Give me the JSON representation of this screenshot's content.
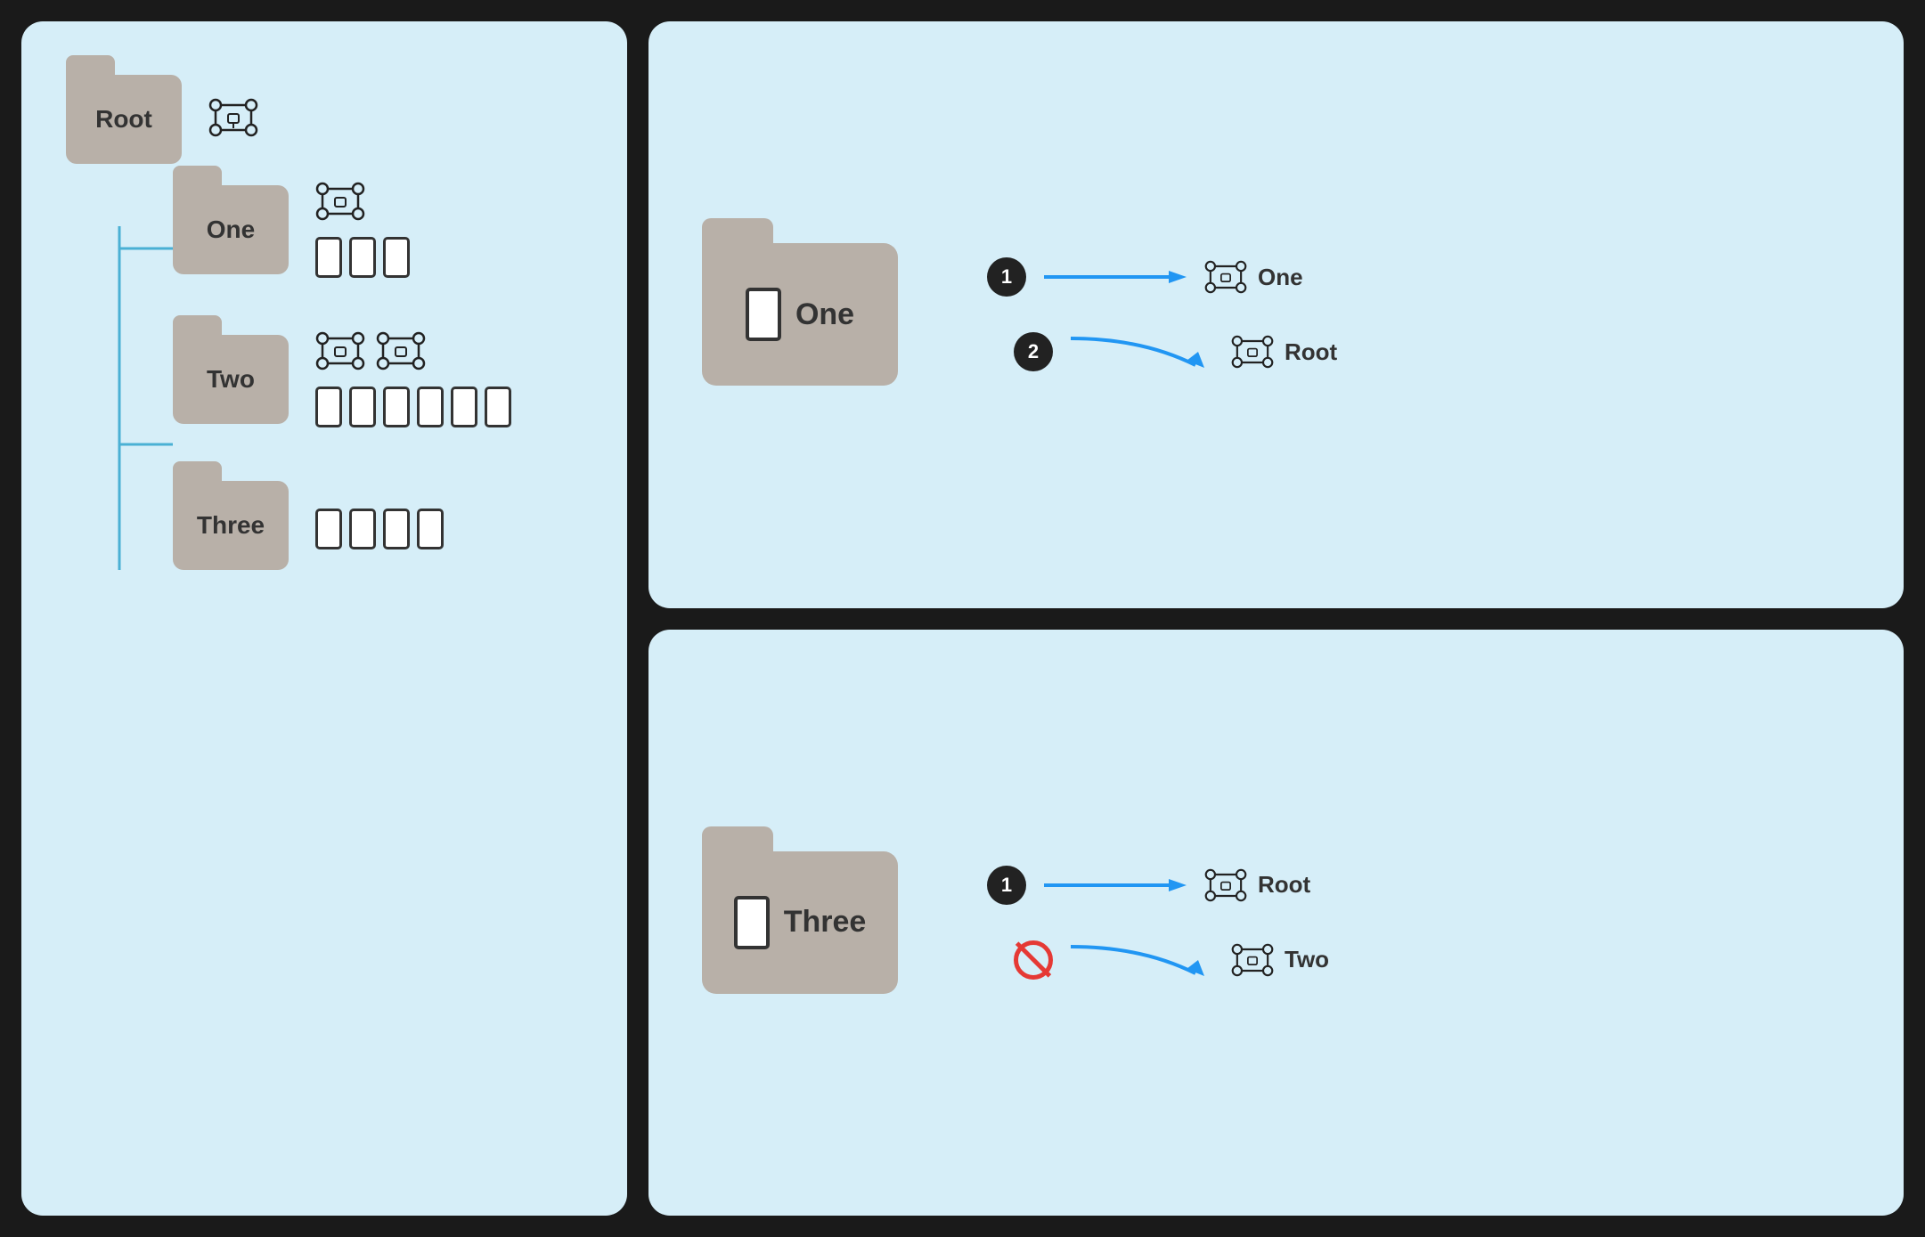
{
  "left": {
    "root_label": "Root",
    "children": [
      {
        "name": "One",
        "drones": 1,
        "phones": 3
      },
      {
        "name": "Two",
        "drones": 2,
        "phones": 6
      },
      {
        "name": "Three",
        "drones": 0,
        "phones": 4
      }
    ]
  },
  "right_top": {
    "folder_label": "One",
    "phone_visible": true,
    "arrows": [
      {
        "badge": "1",
        "label": "One",
        "type": "straight"
      },
      {
        "badge": "2",
        "label": "Root",
        "type": "curved"
      }
    ]
  },
  "right_bottom": {
    "folder_label": "Three",
    "phone_visible": true,
    "arrows": [
      {
        "badge": "1",
        "label": "Root",
        "type": "straight"
      },
      {
        "badge": "blocked",
        "label": "Two",
        "type": "curved"
      }
    ]
  }
}
